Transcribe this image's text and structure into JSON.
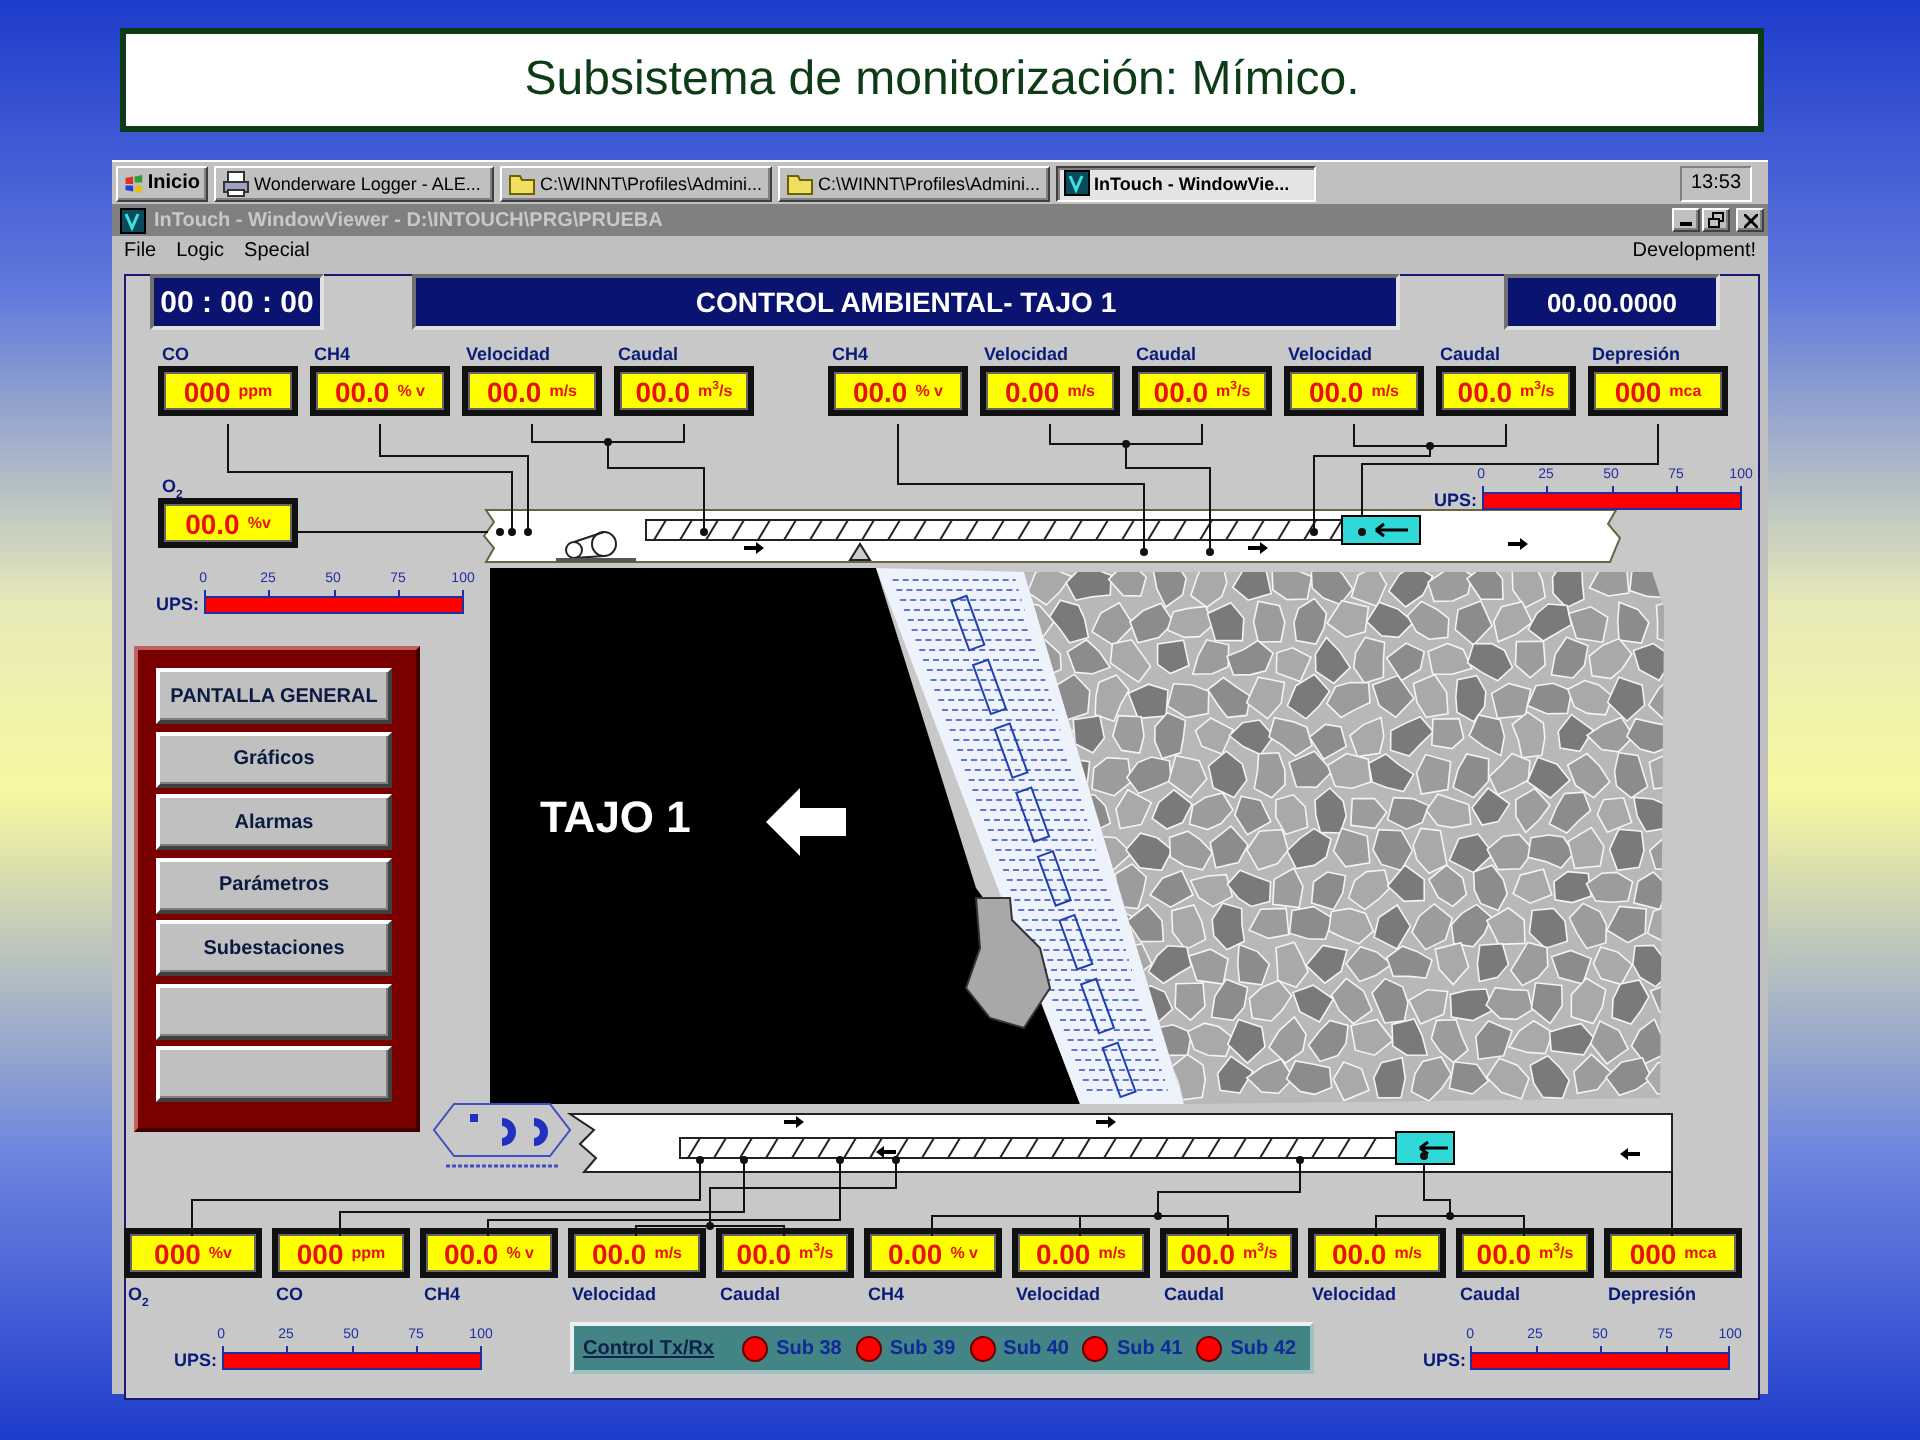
{
  "slide_title": "Subsistema de monitorización: Mímico.",
  "taskbar": {
    "start_button": "Inicio",
    "items": [
      {
        "kind": "logger",
        "label": "Wonderware Logger - ALE...",
        "selected": false
      },
      {
        "kind": "folder",
        "label": "C:\\WINNT\\Profiles\\Admini...",
        "selected": false
      },
      {
        "kind": "folder",
        "label": "C:\\WINNT\\Profiles\\Admini...",
        "selected": false
      },
      {
        "kind": "app",
        "label": "InTouch - WindowVie...",
        "selected": true
      }
    ],
    "clock": "13:53"
  },
  "window": {
    "title": "InTouch - WindowViewer - D:\\INTOUCH\\PRG\\PRUEBA",
    "menu": [
      "File",
      "Logic",
      "Special"
    ],
    "mode": "Development!"
  },
  "header": {
    "timer": "00 : 00 : 00",
    "title": "CONTROL AMBIENTAL- TAJO 1",
    "date": "00.00.0000"
  },
  "top_sensor_groups": [
    [
      {
        "label": "CO",
        "value": "000",
        "unit": "ppm"
      },
      {
        "label": "CH4",
        "value": "00.0",
        "unit": "% v"
      },
      {
        "label": "Velocidad",
        "value": "00.0",
        "unit": "m/s"
      },
      {
        "label": "Caudal",
        "value": "00.0",
        "unit": "m$^{3}$/s"
      }
    ],
    [
      {
        "label": "CH4",
        "value": "00.0",
        "unit": "% v"
      },
      {
        "label": "Velocidad",
        "value": "0.00",
        "unit": "m/s"
      },
      {
        "label": "Caudal",
        "value": "00.0",
        "unit": "m$^{3}$/s"
      },
      {
        "label": "Velocidad",
        "value": "00.0",
        "unit": "m/s"
      },
      {
        "label": "Caudal",
        "value": "00.0",
        "unit": "m$^{3}$/s"
      },
      {
        "label": "Depresión",
        "value": "000",
        "unit": "mca"
      }
    ]
  ],
  "o2_sensor": {
    "label": "O$_{2}$",
    "value": "00.0",
    "unit": "%v"
  },
  "ups_gauges": [
    {
      "label": "UPS:",
      "ticks": [
        "0",
        "25",
        "50",
        "75",
        "100"
      ],
      "level": 1
    },
    {
      "label": "UPS:",
      "ticks": [
        "0",
        "25",
        "50",
        "75",
        "100"
      ],
      "level": 1
    },
    {
      "label": "UPS:",
      "ticks": [
        "0",
        "25",
        "50",
        "75",
        "100"
      ],
      "level": 1
    },
    {
      "label": "UPS:",
      "ticks": [
        "0",
        "25",
        "50",
        "75",
        "100"
      ],
      "level": 1
    }
  ],
  "menu_panel": {
    "buttons": [
      {
        "kind": "label",
        "label": "PANTALLA GENERAL"
      },
      {
        "kind": "label",
        "label": "Gráficos"
      },
      {
        "kind": "label",
        "label": "Alarmas"
      },
      {
        "kind": "label",
        "label": "Parámetros"
      },
      {
        "kind": "label",
        "label": "Subestaciones"
      },
      {
        "kind": "blank"
      },
      {
        "kind": "blank"
      }
    ]
  },
  "mimic": {
    "face_label": "TAJO 1"
  },
  "bottom_sensors": [
    {
      "label": "O$_{2}$",
      "value": "000",
      "unit": "%v"
    },
    {
      "label": "CO",
      "value": "000",
      "unit": "ppm"
    },
    {
      "label": "CH4",
      "value": "00.0",
      "unit": "% v"
    },
    {
      "label": "Velocidad",
      "value": "00.0",
      "unit": "m/s"
    },
    {
      "label": "Caudal",
      "value": "00.0",
      "unit": "m$^{3}$/s"
    },
    {
      "label": "CH4",
      "value": "0.00",
      "unit": "% v"
    },
    {
      "label": "Velocidad",
      "value": "0.00",
      "unit": "m/s"
    },
    {
      "label": "Caudal",
      "value": "00.0",
      "unit": "m$^{3}$/s"
    },
    {
      "label": "Velocidad",
      "value": "00.0",
      "unit": "m/s"
    },
    {
      "label": "Caudal",
      "value": "00.0",
      "unit": "m$^{3}$/s"
    },
    {
      "label": "Depresión",
      "value": "000",
      "unit": "mca"
    }
  ],
  "comms": {
    "title": "Control Tx/Rx",
    "stations": [
      {
        "label": "Sub 38",
        "color": "#ff0000"
      },
      {
        "label": "Sub 39",
        "color": "#ff0000"
      },
      {
        "label": "Sub 40",
        "color": "#ff0000"
      },
      {
        "label": "Sub 41",
        "color": "#ff0000"
      },
      {
        "label": "Sub 42",
        "color": "#ff0000"
      }
    ]
  }
}
